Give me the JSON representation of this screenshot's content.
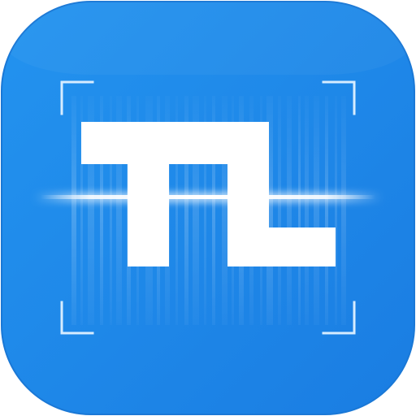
{
  "app_icon": {
    "name": "barcode-scanner-app-icon",
    "logo_text": "TL",
    "colors": {
      "tile_top": "#2393ef",
      "tile_bottom": "#1a7de2",
      "tile_border": "#1a78d6",
      "glyph": "#ffffff",
      "frame_corners": "#d6ecff",
      "barcode_stripes": "#ffffff",
      "scan_line": "#ffffff"
    }
  }
}
